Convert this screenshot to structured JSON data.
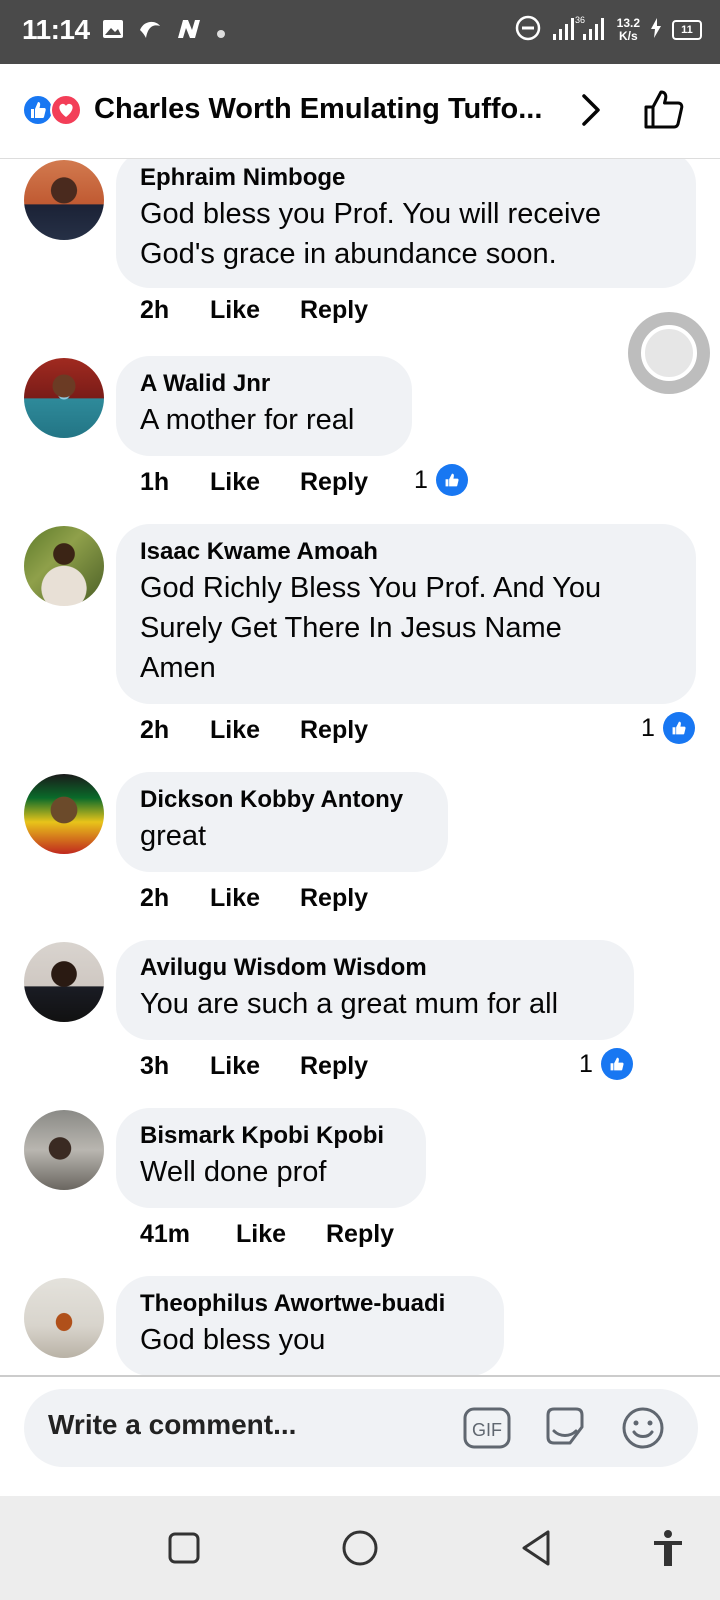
{
  "status_bar": {
    "time": "11:14",
    "net_speed_value": "13.2",
    "net_speed_unit": "K/s",
    "signal_label": "36",
    "battery": "11"
  },
  "header": {
    "title": "Charles Worth Emulating Tuffo..."
  },
  "comments": [
    {
      "name": "Ephraim Nimboge",
      "text_lines": [
        "God bless you Prof.  You will receive",
        "God's grace in abundance soon."
      ],
      "time": "2h",
      "like": "Like",
      "reply": "Reply",
      "likes": ""
    },
    {
      "name": "A Walid Jnr",
      "text_lines": [
        "A mother for real"
      ],
      "time": "1h",
      "like": "Like",
      "reply": "Reply",
      "likes": "1"
    },
    {
      "name": "Isaac Kwame Amoah",
      "text_lines": [
        "God Richly Bless You Prof. And You",
        "Surely Get There In Jesus Name",
        "Amen"
      ],
      "time": "2h",
      "like": "Like",
      "reply": "Reply",
      "likes": "1"
    },
    {
      "name": "Dickson Kobby Antony",
      "text_lines": [
        "great"
      ],
      "time": "2h",
      "like": "Like",
      "reply": "Reply",
      "likes": ""
    },
    {
      "name": "Avilugu Wisdom Wisdom",
      "text_lines": [
        "You are such a great mum for all"
      ],
      "time": "3h",
      "like": "Like",
      "reply": "Reply",
      "likes": "1"
    },
    {
      "name": "Bismark Kpobi Kpobi",
      "text_lines": [
        "Well done prof"
      ],
      "time": "41m",
      "like": "Like",
      "reply": "Reply",
      "likes": ""
    },
    {
      "name": "Theophilus Awortwe-buadi",
      "text_lines": [
        "God bless you"
      ],
      "time": "",
      "like": "",
      "reply": "",
      "likes": ""
    }
  ],
  "composer": {
    "placeholder": "Write a comment...",
    "gif_label": "GIF"
  },
  "colors": {
    "accent": "#1877f2",
    "love": "#f33e58",
    "bubble": "#f0f2f5"
  }
}
